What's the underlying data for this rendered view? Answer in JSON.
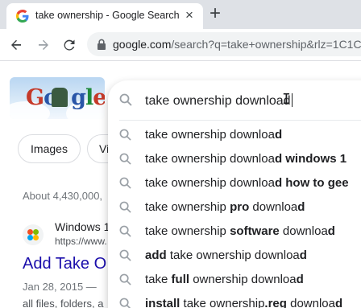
{
  "tab": {
    "title": "take ownership - Google Search",
    "close": "×",
    "new_tab": "+"
  },
  "toolbar": {
    "url_host": "google.com",
    "url_path": "/search?q=take+ownership&rlz=1C1C"
  },
  "page": {
    "logo_letters": [
      "G",
      "o",
      "o",
      "g",
      "l",
      "e"
    ],
    "chips": [
      "Images",
      "Vi"
    ],
    "results_count": "About 4,430,000,",
    "result": {
      "site": "Windows 1",
      "url": "https://www.",
      "title": "Add Take O",
      "date": "Jan 28, 2015 —",
      "snippet": "all files, folders, a"
    }
  },
  "search": {
    "query": "take ownership download",
    "suggestions": [
      {
        "parts": [
          [
            "take ownership downloa",
            false
          ],
          [
            "d",
            true
          ]
        ]
      },
      {
        "parts": [
          [
            "take ownership downloa",
            false
          ],
          [
            "d windows 1",
            true
          ]
        ]
      },
      {
        "parts": [
          [
            "take ownership downloa",
            false
          ],
          [
            "d how to gee",
            true
          ]
        ]
      },
      {
        "parts": [
          [
            "take ownership ",
            false
          ],
          [
            "pro",
            true
          ],
          [
            " downloa",
            false
          ],
          [
            "d",
            true
          ]
        ]
      },
      {
        "parts": [
          [
            "take ownership ",
            false
          ],
          [
            "software",
            true
          ],
          [
            " downloa",
            false
          ],
          [
            "d",
            true
          ]
        ]
      },
      {
        "parts": [
          [
            "add",
            true
          ],
          [
            " take ownership downloa",
            false
          ],
          [
            "d",
            true
          ]
        ]
      },
      {
        "parts": [
          [
            "take ",
            false
          ],
          [
            "full",
            true
          ],
          [
            " ownership downloa",
            false
          ],
          [
            "d",
            true
          ]
        ]
      },
      {
        "parts": [
          [
            "install",
            true
          ],
          [
            " take ownership",
            false
          ],
          [
            ".reg",
            true
          ],
          [
            " downloa",
            false
          ],
          [
            "d",
            true
          ]
        ]
      }
    ]
  },
  "colors": {
    "link": "#1a0dab",
    "tabstrip": "#dee1e6",
    "text": "#202124"
  }
}
